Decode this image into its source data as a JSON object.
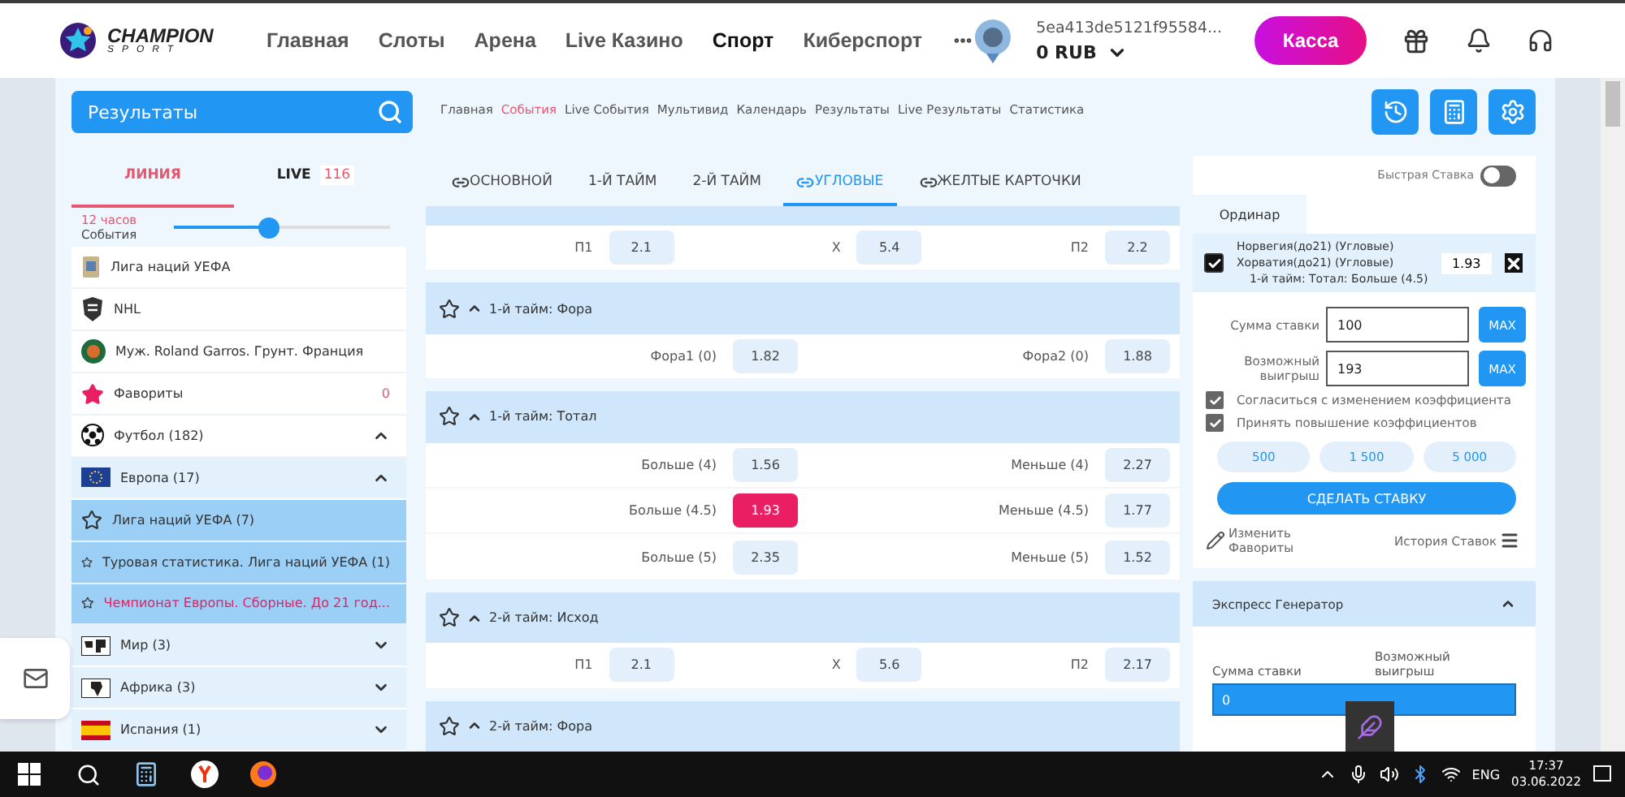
{
  "header": {
    "logo": {
      "title": "CHAMPION",
      "subtitle": "SPORT"
    },
    "nav": [
      {
        "label": "Главная",
        "selected": false
      },
      {
        "label": "Слоты",
        "selected": false
      },
      {
        "label": "Арена",
        "selected": false
      },
      {
        "label": "Live Казино",
        "selected": false
      },
      {
        "label": "Спорт",
        "selected": true
      },
      {
        "label": "Киберспорт",
        "selected": false
      }
    ],
    "account": {
      "id": "5ea413de5121f95584...",
      "balance": "0 RUB"
    },
    "cashier_button": "Касса"
  },
  "subnav": {
    "search": {
      "value": "Результаты"
    },
    "links": [
      {
        "label": "Главная",
        "selected": false
      },
      {
        "label": "События",
        "selected": true
      },
      {
        "label": "Live События",
        "selected": false
      },
      {
        "label": "Мультивид",
        "selected": false
      },
      {
        "label": "Календарь",
        "selected": false
      },
      {
        "label": "Результаты",
        "selected": false
      },
      {
        "label": "Live Результаты",
        "selected": false
      },
      {
        "label": "Статистика",
        "selected": false
      }
    ]
  },
  "sidebar": {
    "tabs": [
      {
        "label": "ЛИНИЯ",
        "selected": true
      },
      {
        "label": "LIVE",
        "count": "116",
        "selected": false
      }
    ],
    "period": {
      "label": "12 часов",
      "caption": "События",
      "level": 0.44
    },
    "pinned": [
      {
        "label": "Лига наций УЕФА"
      },
      {
        "label": "NHL"
      },
      {
        "label": "Муж. Roland Garros. Грунт. Франция"
      }
    ],
    "favorites": {
      "label": "Фавориты",
      "count": "0"
    },
    "sports": [
      {
        "label": "Футбол (182)",
        "expanded": true,
        "children": [
          {
            "label": "Европа (17)",
            "expanded": true,
            "children": [
              {
                "label": "Лига наций УЕФА (7)",
                "selected": false
              },
              {
                "label": "Туровая статистика. Лига наций УЕФА (1)",
                "selected": false
              },
              {
                "label": "Чемпионат Европы. Сборные. До 21 год...",
                "selected": true
              }
            ]
          },
          {
            "label": "Мир (3)",
            "expanded": false
          },
          {
            "label": "Африка (3)",
            "expanded": false
          },
          {
            "label": "Испания (1)",
            "expanded": false
          }
        ]
      }
    ]
  },
  "market_tabs": [
    {
      "label": "ОСНОВНОЙ",
      "linked": true,
      "selected": false
    },
    {
      "label": "1-Й ТАЙМ",
      "linked": false,
      "selected": false
    },
    {
      "label": "2-Й ТАЙМ",
      "linked": false,
      "selected": false
    },
    {
      "label": "УГЛОВЫЕ",
      "linked": true,
      "selected": true
    },
    {
      "label": "ЖЕЛТЫЕ КАРТОЧКИ",
      "linked": true,
      "selected": false
    }
  ],
  "markets": [
    {
      "rows": [
        [
          {
            "label": "П1",
            "odd": "2.1",
            "selected": false
          },
          {
            "label": "X",
            "odd": "5.4",
            "selected": false
          },
          {
            "label": "П2",
            "odd": "2.2",
            "selected": false
          }
        ]
      ]
    },
    {
      "title": "1-й тайм: Фора",
      "expanded": true,
      "rows": [
        [
          {
            "label": "Фора1 (0)",
            "odd": "1.82",
            "selected": false
          },
          {
            "label": "Фора2 (0)",
            "odd": "1.88",
            "selected": false
          }
        ]
      ]
    },
    {
      "title": "1-й тайм: Тотал",
      "expanded": true,
      "rows": [
        [
          {
            "label": "Больше (4)",
            "odd": "1.56",
            "selected": false
          },
          {
            "label": "Меньше (4)",
            "odd": "2.27",
            "selected": false
          }
        ],
        [
          {
            "label": "Больше (4.5)",
            "odd": "1.93",
            "selected": true
          },
          {
            "label": "Меньше (4.5)",
            "odd": "1.77",
            "selected": false
          }
        ],
        [
          {
            "label": "Больше (5)",
            "odd": "2.35",
            "selected": false
          },
          {
            "label": "Меньше (5)",
            "odd": "1.52",
            "selected": false
          }
        ]
      ]
    },
    {
      "title": "2-й тайм: Исход",
      "expanded": true,
      "rows": [
        [
          {
            "label": "П1",
            "odd": "2.1",
            "selected": false
          },
          {
            "label": "X",
            "odd": "5.6",
            "selected": false
          },
          {
            "label": "П2",
            "odd": "2.17",
            "selected": false
          }
        ]
      ]
    },
    {
      "title": "2-й тайм: Фора",
      "expanded": true
    }
  ],
  "betslip": {
    "quick_bet": {
      "label": "Быстрая Ставка",
      "on": false
    },
    "tab": "Ординар",
    "bet": {
      "checked": true,
      "home": "Норвегия(до21) (Угловые)",
      "away": "Хорватия(до21) (Угловые)",
      "odd": "1.93",
      "market": "1-й тайм: Тотал: Больше (4.5)"
    },
    "stake": {
      "label": "Сумма ставки",
      "value": "100",
      "button": "MAX"
    },
    "payout": {
      "label": "Возможный выигрыш",
      "value": "193",
      "button": "MAX"
    },
    "options": [
      {
        "label": "Согласиться с изменением коэффициента",
        "checked": true
      },
      {
        "label": "Принять повышение коэффициентов",
        "checked": true
      }
    ],
    "amounts": [
      "500",
      "1 500",
      "5 000"
    ],
    "submit": "СДЕЛАТЬ СТАВКУ",
    "edit_favorites": "Изменить Фавориты",
    "history": "История Ставок"
  },
  "express": {
    "title": "Экспресс Генератор",
    "expanded": true,
    "stake_label": "Сумма ставки",
    "payout_label": "Возможный выигрыш",
    "stake_value": "0"
  },
  "taskbar": {
    "language": "ENG",
    "time": "17:37",
    "date": "03.06.2022"
  }
}
